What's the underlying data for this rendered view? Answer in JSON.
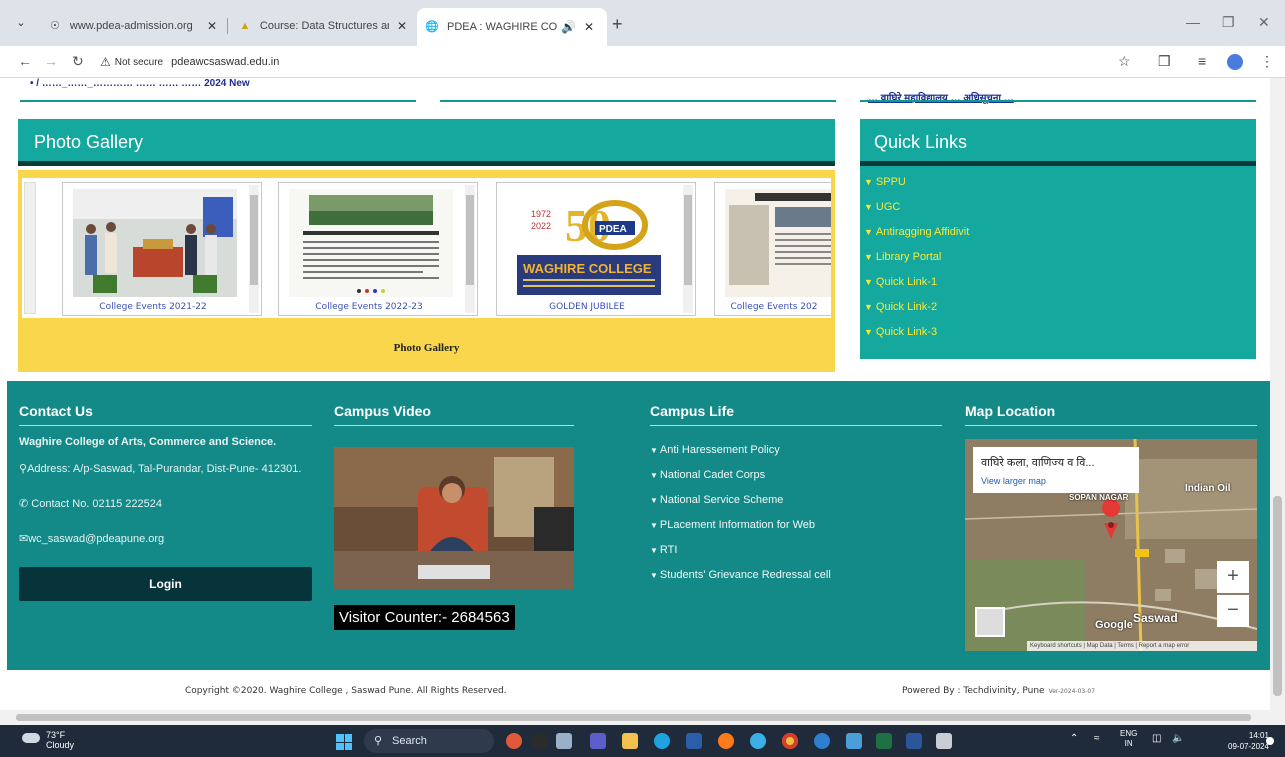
{
  "browser": {
    "tabs": [
      {
        "title": "www.pdea-admission.org",
        "active": false
      },
      {
        "title": "Course: Data Structures and Al",
        "active": false
      },
      {
        "title": "PDEA : WAGHIRE COLLEGE",
        "active": true
      }
    ],
    "new_tab": "+",
    "security_label": "Not secure",
    "url": "pdeawcsaswad.edu.in"
  },
  "top_strip": {
    "left_text": "• / ……_……_………… …… …… …… 2024 New",
    "right_text": "… वाघिरे महाविद्यालय … अधिसूचना …"
  },
  "gallery": {
    "heading": "Photo Gallery",
    "items": [
      {
        "caption": "College Events 2021-22"
      },
      {
        "caption": "College Events 2022-23"
      },
      {
        "caption": "GOLDEN JUBILEE"
      },
      {
        "caption": "College Events 202"
      }
    ],
    "footer_caption": "Photo Gallery",
    "jubilee_years": [
      "1972",
      "2022"
    ],
    "jubilee_number": "50",
    "jubilee_badge": "PDEA",
    "jubilee_title": "WAGHIRE COLLEGE"
  },
  "quick_links": {
    "heading": "Quick Links",
    "items": [
      "SPPU",
      "UGC",
      "Antiragging Affidivit",
      "Library Portal",
      "Quick Link-1",
      "Quick Link-2",
      "Quick Link-3"
    ]
  },
  "contact": {
    "heading": "Contact Us",
    "college": "Waghire College of Arts, Commerce and Science.",
    "address": "Address: A/p-Saswad, Tal-Purandar, Dist-Pune- 412301.",
    "phone": "Contact No. 02115 222524",
    "email": "wc_saswad@pdeapune.org",
    "login": "Login"
  },
  "campus_video": {
    "heading": "Campus Video",
    "visitor_counter": "Visitor Counter:- 2684563"
  },
  "campus_life": {
    "heading": "Campus Life",
    "items": [
      "Anti Haressement Policy",
      "National Cadet Corps",
      "National Service Scheme",
      "PLacement Information for Web",
      "RTI",
      "Students' Grievance Redressal cell"
    ]
  },
  "map": {
    "heading": "Map Location",
    "place_name": "वाघिरे कला, वाणिज्य व वि...",
    "view_larger": "View larger map",
    "labels": [
      "Indian Oil",
      "SOPAN NAGAR",
      "Saswad",
      "Google"
    ],
    "attribution": "Keyboard shortcuts | Map Data | Terms | Report a map error"
  },
  "footer": {
    "copyright": "Copyright ©2020. Waghire College , Saswad Pune. All Rights Reserved.",
    "powered_by": "Powered By : Techdivinity, Pune",
    "version": "Ver-2024-03-07"
  },
  "taskbar": {
    "temperature": "73°F",
    "weather": "Cloudy",
    "search_placeholder": "Search",
    "lang_top": "ENG",
    "lang_bottom": "IN",
    "time": "14:01",
    "date": "09-07-2024"
  },
  "colors": {
    "teal_header": "#14a89f",
    "footer_bg": "#138a88",
    "gallery_bg": "#f9d64c",
    "link_yellow": "#f5ea3a",
    "login_bg": "#07333a"
  }
}
